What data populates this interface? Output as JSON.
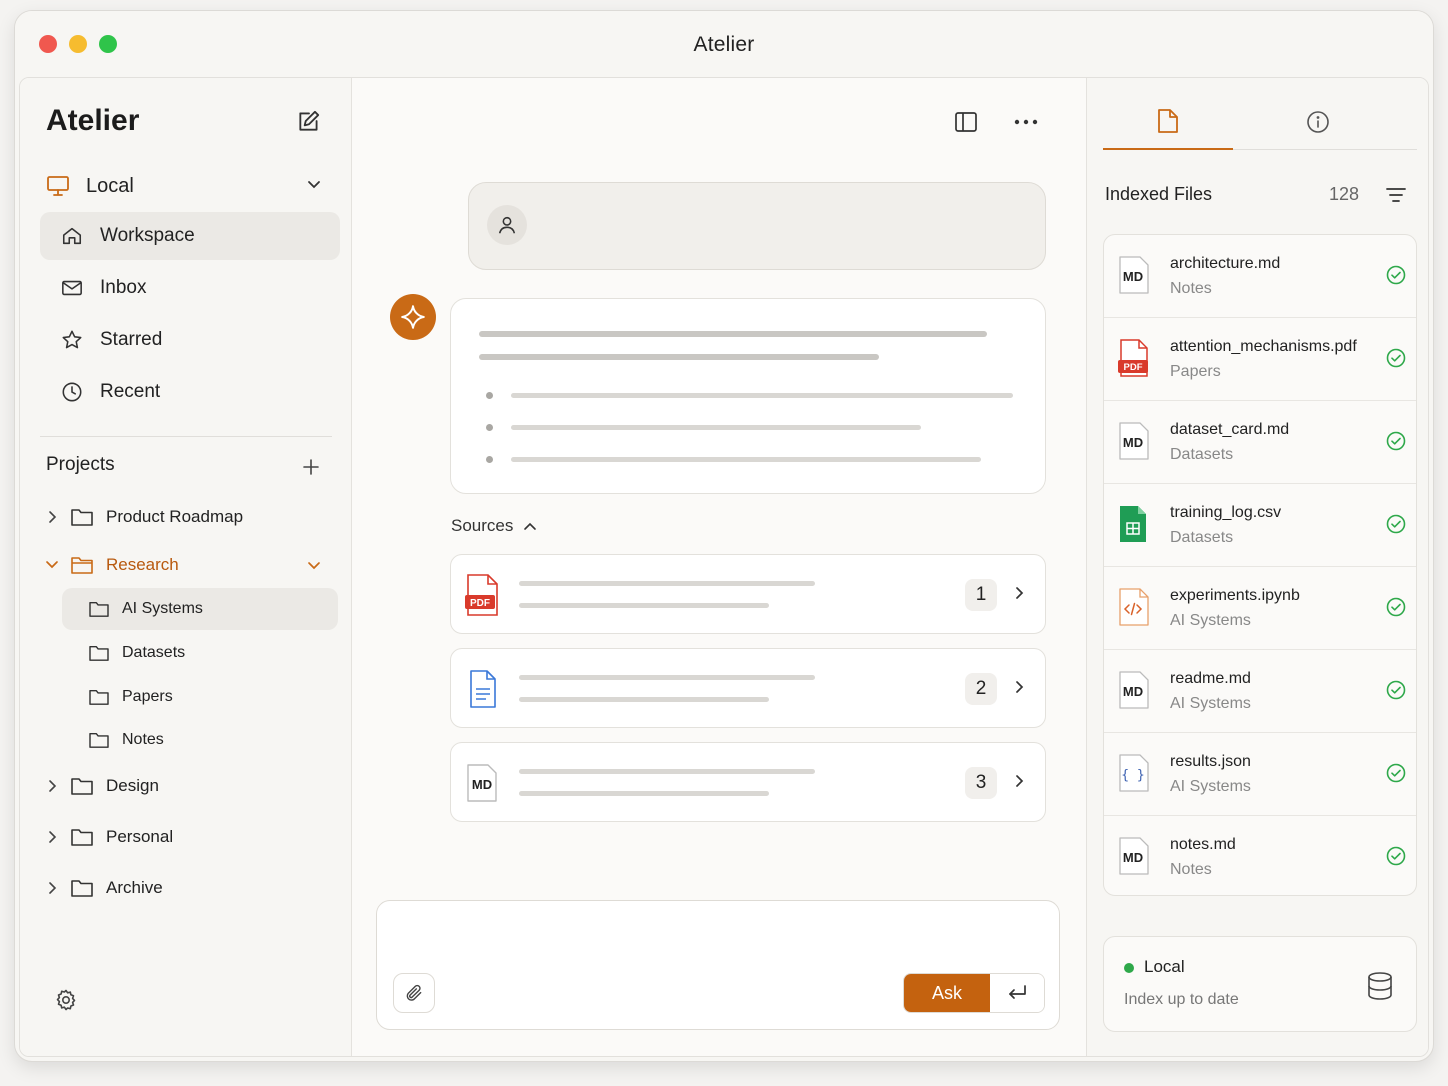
{
  "window": {
    "title": "Atelier"
  },
  "sidebar": {
    "brand": "Atelier",
    "location": "Local",
    "nav": [
      {
        "label": "Workspace",
        "icon": "home-icon",
        "active": true
      },
      {
        "label": "Inbox",
        "icon": "mail-icon"
      },
      {
        "label": "Starred",
        "icon": "star-icon"
      },
      {
        "label": "Recent",
        "icon": "clock-icon"
      }
    ],
    "projects_title": "Projects",
    "projects": [
      {
        "label": "Product Roadmap",
        "expanded": false
      },
      {
        "label": "Research",
        "expanded": true,
        "children": [
          "AI Systems",
          "Datasets",
          "Papers",
          "Notes"
        ],
        "active_child": "AI Systems"
      },
      {
        "label": "Design",
        "expanded": false
      },
      {
        "label": "Personal",
        "expanded": false
      },
      {
        "label": "Archive",
        "expanded": false
      }
    ]
  },
  "main": {
    "sources_label": "Sources",
    "sources": [
      {
        "num": "1",
        "type": "PDF"
      },
      {
        "num": "2",
        "type": "doc"
      },
      {
        "num": "3",
        "type": "MD"
      }
    ],
    "composer": {
      "ask_label": "Ask"
    }
  },
  "right": {
    "indexed_title": "Indexed Files",
    "indexed_count": "128",
    "files": [
      {
        "name": "architecture.md",
        "folder": "Notes",
        "type": "MD"
      },
      {
        "name": "attention_mechanisms.pdf",
        "folder": "Papers",
        "type": "PDF"
      },
      {
        "name": "dataset_card.md",
        "folder": "Datasets",
        "type": "MD"
      },
      {
        "name": "training_log.csv",
        "folder": "Datasets",
        "type": "CSV"
      },
      {
        "name": "experiments.ipynb",
        "folder": "AI Systems",
        "type": "IPYNB"
      },
      {
        "name": "readme.md",
        "folder": "AI Systems",
        "type": "MD"
      },
      {
        "name": "results.json",
        "folder": "AI Systems",
        "type": "JSON"
      },
      {
        "name": "notes.md",
        "folder": "Notes",
        "type": "MD"
      }
    ],
    "status": {
      "title": "Local",
      "subtitle": "Index up to date"
    }
  },
  "colors": {
    "accent": "#c4620f",
    "status_ok": "#2ea84a",
    "pdf": "#d93a2b",
    "csv": "#1f9d55",
    "doc": "#3a78d8"
  }
}
